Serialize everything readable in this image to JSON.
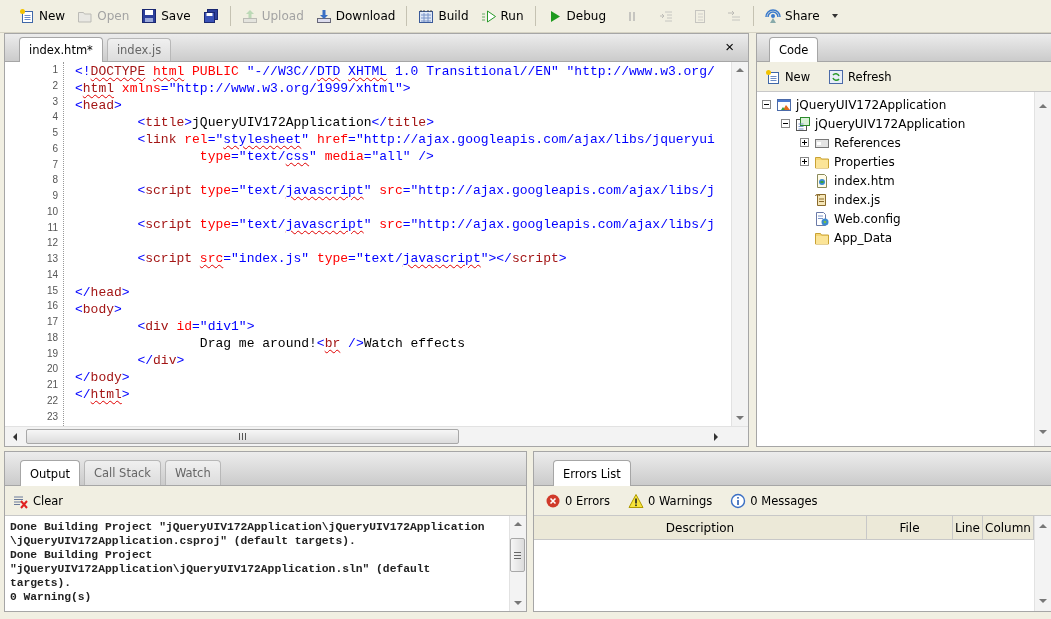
{
  "toolbar": {
    "groups": [
      {
        "items": [
          {
            "kind": "new",
            "label": "New",
            "disabled": false
          },
          {
            "kind": "open",
            "label": "Open",
            "disabled": true
          },
          {
            "kind": "save",
            "label": "Save",
            "disabled": false
          },
          {
            "kind": "save-all",
            "disabled": false
          }
        ]
      },
      {
        "items": [
          {
            "kind": "upload",
            "label": "Upload",
            "disabled": true
          },
          {
            "kind": "download",
            "label": "Download",
            "disabled": false
          }
        ]
      },
      {
        "items": [
          {
            "kind": "build",
            "label": "Build",
            "disabled": false
          },
          {
            "kind": "run",
            "label": "Run",
            "disabled": false
          }
        ]
      },
      {
        "items": [
          {
            "kind": "debug",
            "label": "Debug",
            "disabled": false
          },
          {
            "kind": "pause",
            "disabled": true
          },
          {
            "kind": "step-over",
            "disabled": true
          },
          {
            "kind": "step-into",
            "disabled": true
          },
          {
            "kind": "step-out",
            "disabled": true
          }
        ]
      },
      {
        "items": [
          {
            "kind": "share",
            "label": "Share",
            "disabled": false,
            "menu": true
          }
        ]
      }
    ]
  },
  "editor": {
    "tabs": [
      {
        "label": "index.htm*",
        "selected": true
      },
      {
        "label": "index.js",
        "selected": false
      }
    ],
    "close": "×",
    "line_numbers": [
      "1",
      "2",
      "3",
      "4",
      "5",
      "6",
      "7",
      "8",
      "9",
      "10",
      "11",
      "12",
      "13",
      "14",
      "15",
      "16",
      "17",
      "18",
      "19",
      "20",
      "21",
      "22",
      "23"
    ],
    "lines": [
      {
        "kind": "code",
        "tokens": [
          {
            "text": "<!",
            "kind": "punct"
          },
          {
            "text": "DOCTYPE ",
            "kind": "tag-misspelled"
          },
          {
            "text": "html ",
            "kind": "attr-misspelled"
          },
          {
            "text": "PUBLIC ",
            "kind": "attr"
          },
          {
            "text": "\"-//W3C//",
            "kind": "punct"
          },
          {
            "text": "DTD ",
            "kind": "punct-misspelled"
          },
          {
            "text": "XHTML",
            "kind": "punct-misspelled"
          },
          {
            "text": " 1.0 Transitional//EN\" \"http://www.w3.org/",
            "kind": "punct"
          }
        ]
      },
      {
        "kind": "code",
        "tokens": [
          {
            "text": "<",
            "kind": "punct"
          },
          {
            "text": "html ",
            "kind": "tag-misspelled"
          },
          {
            "text": "xmlns",
            "kind": "attr"
          },
          {
            "text": "=\"http://www.w3.org/1999/xhtml\">",
            "kind": "punct"
          }
        ]
      },
      {
        "kind": "code",
        "tokens": [
          {
            "text": "<",
            "kind": "punct"
          },
          {
            "text": "head",
            "kind": "tag"
          },
          {
            "text": ">",
            "kind": "punct"
          }
        ]
      },
      {
        "kind": "code",
        "tokens": [
          {
            "text": "\t<",
            "kind": "punct"
          },
          {
            "text": "title",
            "kind": "tag"
          },
          {
            "text": ">",
            "kind": "punct"
          },
          {
            "text": "jQueryUIV172Application",
            "kind": "text"
          },
          {
            "text": "</",
            "kind": "punct"
          },
          {
            "text": "title",
            "kind": "tag"
          },
          {
            "text": ">",
            "kind": "punct"
          }
        ]
      },
      {
        "kind": "code",
        "tokens": [
          {
            "text": "\t<",
            "kind": "punct"
          },
          {
            "text": "link ",
            "kind": "tag"
          },
          {
            "text": "rel",
            "kind": "attr"
          },
          {
            "text": "=\"",
            "kind": "punct"
          },
          {
            "text": "stylesheet",
            "kind": "punct-misspelled"
          },
          {
            "text": "\" ",
            "kind": "punct"
          },
          {
            "text": "href",
            "kind": "attr"
          },
          {
            "text": "=\"http://ajax.googleapis.com/ajax/libs/jqueryui",
            "kind": "punct"
          }
        ]
      },
      {
        "kind": "code",
        "tokens": [
          {
            "text": "\t\ttype",
            "kind": "attr"
          },
          {
            "text": "=\"text/",
            "kind": "punct"
          },
          {
            "text": "css",
            "kind": "punct-misspelled"
          },
          {
            "text": "\" ",
            "kind": "punct"
          },
          {
            "text": "media",
            "kind": "attr"
          },
          {
            "text": "=\"all\" />",
            "kind": "punct"
          }
        ]
      },
      {
        "kind": "blank"
      },
      {
        "kind": "code",
        "tokens": [
          {
            "text": "\t<",
            "kind": "punct"
          },
          {
            "text": "script ",
            "kind": "tag"
          },
          {
            "text": "type",
            "kind": "attr"
          },
          {
            "text": "=\"text/",
            "kind": "punct"
          },
          {
            "text": "javascript",
            "kind": "punct-misspelled"
          },
          {
            "text": "\" ",
            "kind": "punct"
          },
          {
            "text": "src",
            "kind": "attr"
          },
          {
            "text": "=\"http://ajax.googleapis.com/ajax/libs/j",
            "kind": "punct"
          }
        ]
      },
      {
        "kind": "blank"
      },
      {
        "kind": "code",
        "tokens": [
          {
            "text": "\t<",
            "kind": "punct"
          },
          {
            "text": "script ",
            "kind": "tag"
          },
          {
            "text": "type",
            "kind": "attr"
          },
          {
            "text": "=\"text/",
            "kind": "punct"
          },
          {
            "text": "javascript",
            "kind": "punct-misspelled"
          },
          {
            "text": "\" ",
            "kind": "punct"
          },
          {
            "text": "src",
            "kind": "attr"
          },
          {
            "text": "=\"http://ajax.googleapis.com/ajax/libs/j",
            "kind": "punct"
          }
        ]
      },
      {
        "kind": "blank"
      },
      {
        "kind": "code",
        "tokens": [
          {
            "text": "\t<",
            "kind": "punct"
          },
          {
            "text": "script ",
            "kind": "tag"
          },
          {
            "text": "src",
            "kind": "attr-misspelled"
          },
          {
            "text": "=\"index.js\" ",
            "kind": "punct"
          },
          {
            "text": "type",
            "kind": "attr"
          },
          {
            "text": "=\"text/",
            "kind": "punct"
          },
          {
            "text": "javascript",
            "kind": "punct-misspelled"
          },
          {
            "text": "\"></",
            "kind": "punct"
          },
          {
            "text": "script",
            "kind": "tag"
          },
          {
            "text": ">",
            "kind": "punct"
          }
        ]
      },
      {
        "kind": "blank"
      },
      {
        "kind": "code",
        "tokens": [
          {
            "text": "</",
            "kind": "punct"
          },
          {
            "text": "head",
            "kind": "tag"
          },
          {
            "text": ">",
            "kind": "punct"
          }
        ]
      },
      {
        "kind": "code",
        "tokens": [
          {
            "text": "<",
            "kind": "punct"
          },
          {
            "text": "body",
            "kind": "tag"
          },
          {
            "text": ">",
            "kind": "punct"
          }
        ]
      },
      {
        "kind": "code",
        "tokens": [
          {
            "text": "\t<",
            "kind": "punct"
          },
          {
            "text": "div ",
            "kind": "tag"
          },
          {
            "text": "id",
            "kind": "attr"
          },
          {
            "text": "=\"div1\">",
            "kind": "punct"
          }
        ]
      },
      {
        "kind": "code",
        "tokens": [
          {
            "text": "\t\tDrag me around!",
            "kind": "text"
          },
          {
            "text": "<",
            "kind": "punct"
          },
          {
            "text": "br",
            "kind": "tag-misspelled"
          },
          {
            "text": " />",
            "kind": "punct"
          },
          {
            "text": "Watch effects",
            "kind": "text"
          }
        ]
      },
      {
        "kind": "code",
        "tokens": [
          {
            "text": "\t</",
            "kind": "punct"
          },
          {
            "text": "div",
            "kind": "tag"
          },
          {
            "text": ">",
            "kind": "punct"
          }
        ]
      },
      {
        "kind": "code",
        "tokens": [
          {
            "text": "</",
            "kind": "punct"
          },
          {
            "text": "body",
            "kind": "tag"
          },
          {
            "text": ">",
            "kind": "punct"
          }
        ]
      },
      {
        "kind": "code",
        "tokens": [
          {
            "text": "</",
            "kind": "punct"
          },
          {
            "text": "html",
            "kind": "tag-misspelled"
          },
          {
            "text": ">",
            "kind": "punct"
          }
        ]
      }
    ]
  },
  "explorer": {
    "tabs": [
      {
        "label": "Code",
        "selected": true
      }
    ],
    "actions": [
      {
        "kind": "new",
        "label": "New"
      },
      {
        "kind": "refresh",
        "label": "Refresh"
      }
    ],
    "tree": [
      {
        "label": "jQueryUIV172Application",
        "kind": "solution",
        "expanded": true,
        "children": [
          {
            "label": "jQueryUIV172Application",
            "kind": "project",
            "expanded": true,
            "children": [
              {
                "label": "References",
                "kind": "references",
                "expanded": false
              },
              {
                "label": "Properties",
                "kind": "folder",
                "expanded": false
              },
              {
                "label": "index.htm",
                "kind": "html-file"
              },
              {
                "label": "index.js",
                "kind": "js-file"
              },
              {
                "label": "Web.config",
                "kind": "config-file"
              },
              {
                "label": "App_Data",
                "kind": "folder"
              }
            ]
          }
        ]
      }
    ]
  },
  "output": {
    "tabs": [
      {
        "label": "Output",
        "selected": true
      },
      {
        "label": "Call Stack",
        "selected": false
      },
      {
        "label": "Watch",
        "selected": false
      }
    ],
    "actions": [
      {
        "kind": "clear",
        "label": "Clear"
      }
    ],
    "lines": [
      "Done Building Project \"jQueryUIV172Application\\jQueryUIV172Application",
      "\\jQueryUIV172Application.csproj\" (default targets).",
      "Done Building Project",
      "\"jQueryUIV172Application\\jQueryUIV172Application.sln\" (default",
      "targets).",
      "0 Warning(s)"
    ]
  },
  "errors": {
    "tabs": [
      {
        "label": "Errors List",
        "selected": true
      }
    ],
    "counters": [
      {
        "kind": "error",
        "text": "0 Errors"
      },
      {
        "kind": "warning",
        "text": "0 Warnings"
      },
      {
        "kind": "info",
        "text": "0 Messages"
      }
    ],
    "columns": [
      "Description",
      "File",
      "Line",
      "Column"
    ]
  }
}
